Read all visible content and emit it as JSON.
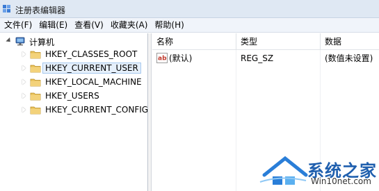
{
  "window": {
    "title": "注册表编辑器"
  },
  "menu": {
    "items": [
      "文件(F)",
      "编辑(E)",
      "查看(V)",
      "收藏夹(A)",
      "帮助(H)"
    ]
  },
  "tree": {
    "root_label": "计算机",
    "items": [
      {
        "label": "HKEY_CLASSES_ROOT",
        "selected": false
      },
      {
        "label": "HKEY_CURRENT_USER",
        "selected": true
      },
      {
        "label": "HKEY_LOCAL_MACHINE",
        "selected": false
      },
      {
        "label": "HKEY_USERS",
        "selected": false
      },
      {
        "label": "HKEY_CURRENT_CONFIG",
        "selected": false
      }
    ]
  },
  "list": {
    "columns": [
      "名称",
      "类型",
      "数据"
    ],
    "rows": [
      {
        "name": "(默认)",
        "type": "REG_SZ",
        "data": "(数值未设置)"
      }
    ]
  },
  "watermark": {
    "title": "系统之家",
    "url": "Win10net.com"
  },
  "colors": {
    "titlebar": "#dfe8f3",
    "folder": "#e8c25a",
    "selection_border": "#a6c8ee",
    "watermark_blue": "#1f5fae"
  }
}
